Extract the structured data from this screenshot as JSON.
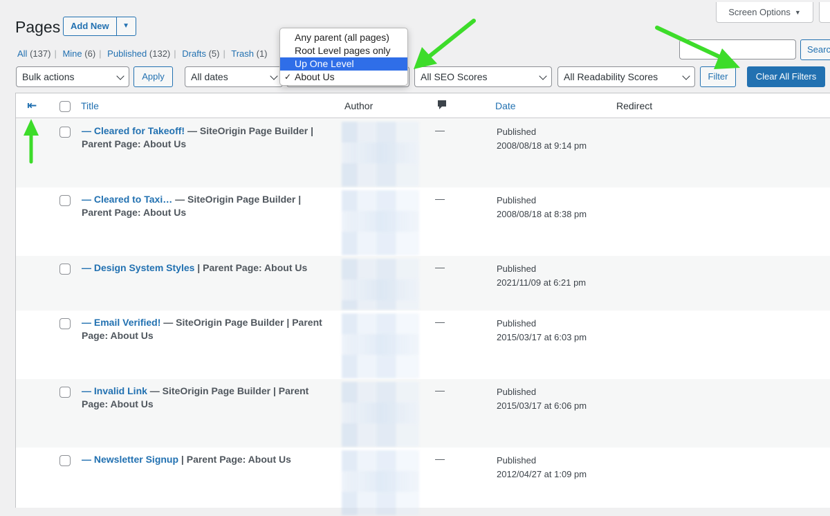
{
  "screen_options": {
    "label": "Screen Options",
    "arrow": "▼"
  },
  "header": {
    "title": "Pages",
    "add_new": "Add New",
    "split_arrow": "▼"
  },
  "views": [
    {
      "label": "All",
      "count": "(137)"
    },
    {
      "label": "Mine",
      "count": "(6)"
    },
    {
      "label": "Published",
      "count": "(132)"
    },
    {
      "label": "Drafts",
      "count": "(5)"
    },
    {
      "label": "Trash",
      "count": "(1)"
    }
  ],
  "views_sep": "|",
  "search": {
    "placeholder": "",
    "button": "Searc"
  },
  "filters": {
    "bulk_actions": "Bulk actions",
    "apply": "Apply",
    "all_dates": "All dates",
    "seo": "All SEO Scores",
    "readability": "All Readability Scores",
    "filter": "Filter",
    "clear_all": "Clear All Filters"
  },
  "parent_dropdown": {
    "options": [
      "Any parent (all pages)",
      "Root Level pages only",
      "Up One Level",
      "About Us"
    ],
    "selected_index": 2,
    "checked_index": 3,
    "check_glyph": "✓"
  },
  "table": {
    "back_icon": "⇤",
    "columns": {
      "title": "Title",
      "author": "Author",
      "comments_icon": "comment-icon",
      "date": "Date",
      "redirect": "Redirect"
    },
    "rows": [
      {
        "title": "— Cleared for Takeoff!",
        "meta": " — SiteOrigin Page Builder | Parent Page: About Us",
        "comments": "—",
        "status": "Published",
        "date": "2008/08/18 at 9:14 pm"
      },
      {
        "title": "— Cleared to Taxi…",
        "meta": " — SiteOrigin Page Builder | Parent Page: About Us",
        "comments": "—",
        "status": "Published",
        "date": "2008/08/18 at 8:38 pm"
      },
      {
        "title": "— Design System Styles",
        "meta": " | Parent Page: About Us",
        "comments": "—",
        "status": "Published",
        "date": "2021/11/09 at 6:21 pm"
      },
      {
        "title": "— Email Verified!",
        "meta": " — SiteOrigin Page Builder | Parent Page: About Us",
        "comments": "—",
        "status": "Published",
        "date": "2015/03/17 at 6:03 pm"
      },
      {
        "title": "— Invalid Link",
        "meta": " — SiteOrigin Page Builder | Parent Page: About Us",
        "comments": "—",
        "status": "Published",
        "date": "2015/03/17 at 6:06 pm"
      },
      {
        "title": "— Newsletter Signup",
        "meta": " | Parent Page: About Us",
        "comments": "—",
        "status": "Published",
        "date": "2012/04/27 at 1:09 pm"
      }
    ]
  },
  "colors": {
    "link": "#2271b1",
    "primary": "#2271b1",
    "highlight": "#2f6ee8",
    "annotation_arrow": "#3ddc2a"
  }
}
